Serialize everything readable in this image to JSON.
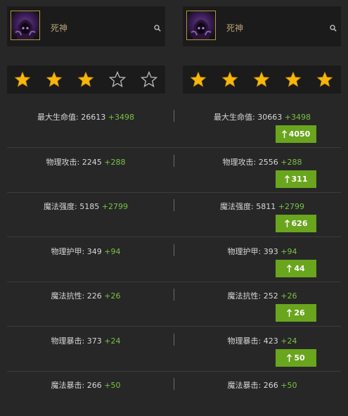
{
  "compare": {
    "left_hero": {
      "name": "死神",
      "rating": 3,
      "max_rating": 5
    },
    "right_hero": {
      "name": "死神",
      "rating": 5,
      "max_rating": 5
    }
  },
  "stats": [
    {
      "left_label": "最大生命值: 26613",
      "left_bonus": "+3498",
      "right_label": "最大生命值: 30663",
      "right_bonus": "+3498",
      "diff": "4050"
    },
    {
      "left_label": "物理攻击: 2245",
      "left_bonus": "+288",
      "right_label": "物理攻击: 2556",
      "right_bonus": "+288",
      "diff": "311"
    },
    {
      "left_label": "魔法强度: 5185",
      "left_bonus": "+2799",
      "right_label": "魔法强度: 5811",
      "right_bonus": "+2799",
      "diff": "626"
    },
    {
      "left_label": "物理护甲: 349",
      "left_bonus": "+94",
      "right_label": "物理护甲: 393",
      "right_bonus": "+94",
      "diff": "44"
    },
    {
      "left_label": "魔法抗性: 226",
      "left_bonus": "+26",
      "right_label": "魔法抗性: 252",
      "right_bonus": "+26",
      "diff": "26"
    },
    {
      "left_label": "物理暴击: 373",
      "left_bonus": "+24",
      "right_label": "物理暴击: 423",
      "right_bonus": "+24",
      "diff": "50"
    },
    {
      "left_label": "魔法暴击: 266",
      "left_bonus": "+50",
      "right_label": "魔法暴击: 266",
      "right_bonus": "+50",
      "diff": ""
    }
  ],
  "colors": {
    "star_filled": "#f5b80a",
    "bonus": "#7ac143",
    "diff_bg": "#6aa51e",
    "name": "#b9a274"
  },
  "icons": {
    "search": "search-icon",
    "star": "star-icon",
    "arrow": "arrow-up-icon"
  }
}
